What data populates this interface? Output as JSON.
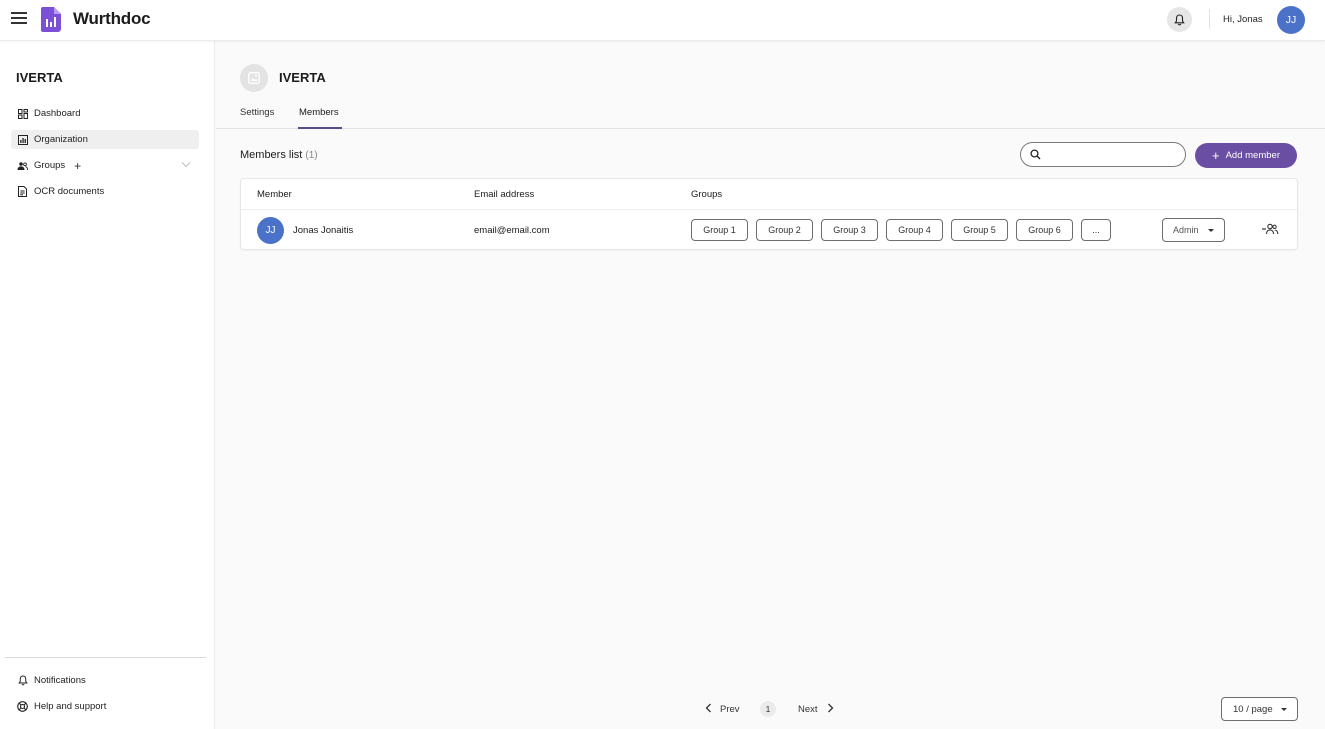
{
  "header": {
    "brand": "Wurthdoc",
    "greeting": "Hi, Jonas",
    "avatar_initials": "JJ",
    "accent_color": "#6a4ea3",
    "avatar_color": "#4a72c8"
  },
  "sidebar": {
    "org_name": "IVERTA",
    "items": [
      {
        "label": "Dashboard",
        "icon": "dashboard-icon"
      },
      {
        "label": "Organization",
        "icon": "organization-icon",
        "active": true
      },
      {
        "label": "Groups",
        "icon": "groups-icon"
      },
      {
        "label": "OCR documents",
        "icon": "document-icon"
      }
    ],
    "bottom_items": [
      {
        "label": "Notifications",
        "icon": "bell-icon"
      },
      {
        "label": "Help and support",
        "icon": "help-icon"
      }
    ]
  },
  "main": {
    "org_title": "IVERTA",
    "tabs": [
      {
        "label": "Settings"
      },
      {
        "label": "Members",
        "active": true
      }
    ],
    "list_title": "Members list",
    "list_count": "(1)",
    "search_placeholder": "",
    "add_button": "Add member",
    "table": {
      "columns": [
        "Member",
        "Email address",
        "Groups"
      ],
      "rows": [
        {
          "initials": "JJ",
          "name": "Jonas Jonaitis",
          "email": "email@email.com",
          "groups": [
            "Group 1",
            "Group 2",
            "Group 3",
            "Group 4",
            "Group 5",
            "Group 6",
            "..."
          ],
          "role": "Admin"
        }
      ]
    },
    "pagination": {
      "prev": "Prev",
      "page": "1",
      "next": "Next",
      "per_page": "10 / page"
    }
  }
}
